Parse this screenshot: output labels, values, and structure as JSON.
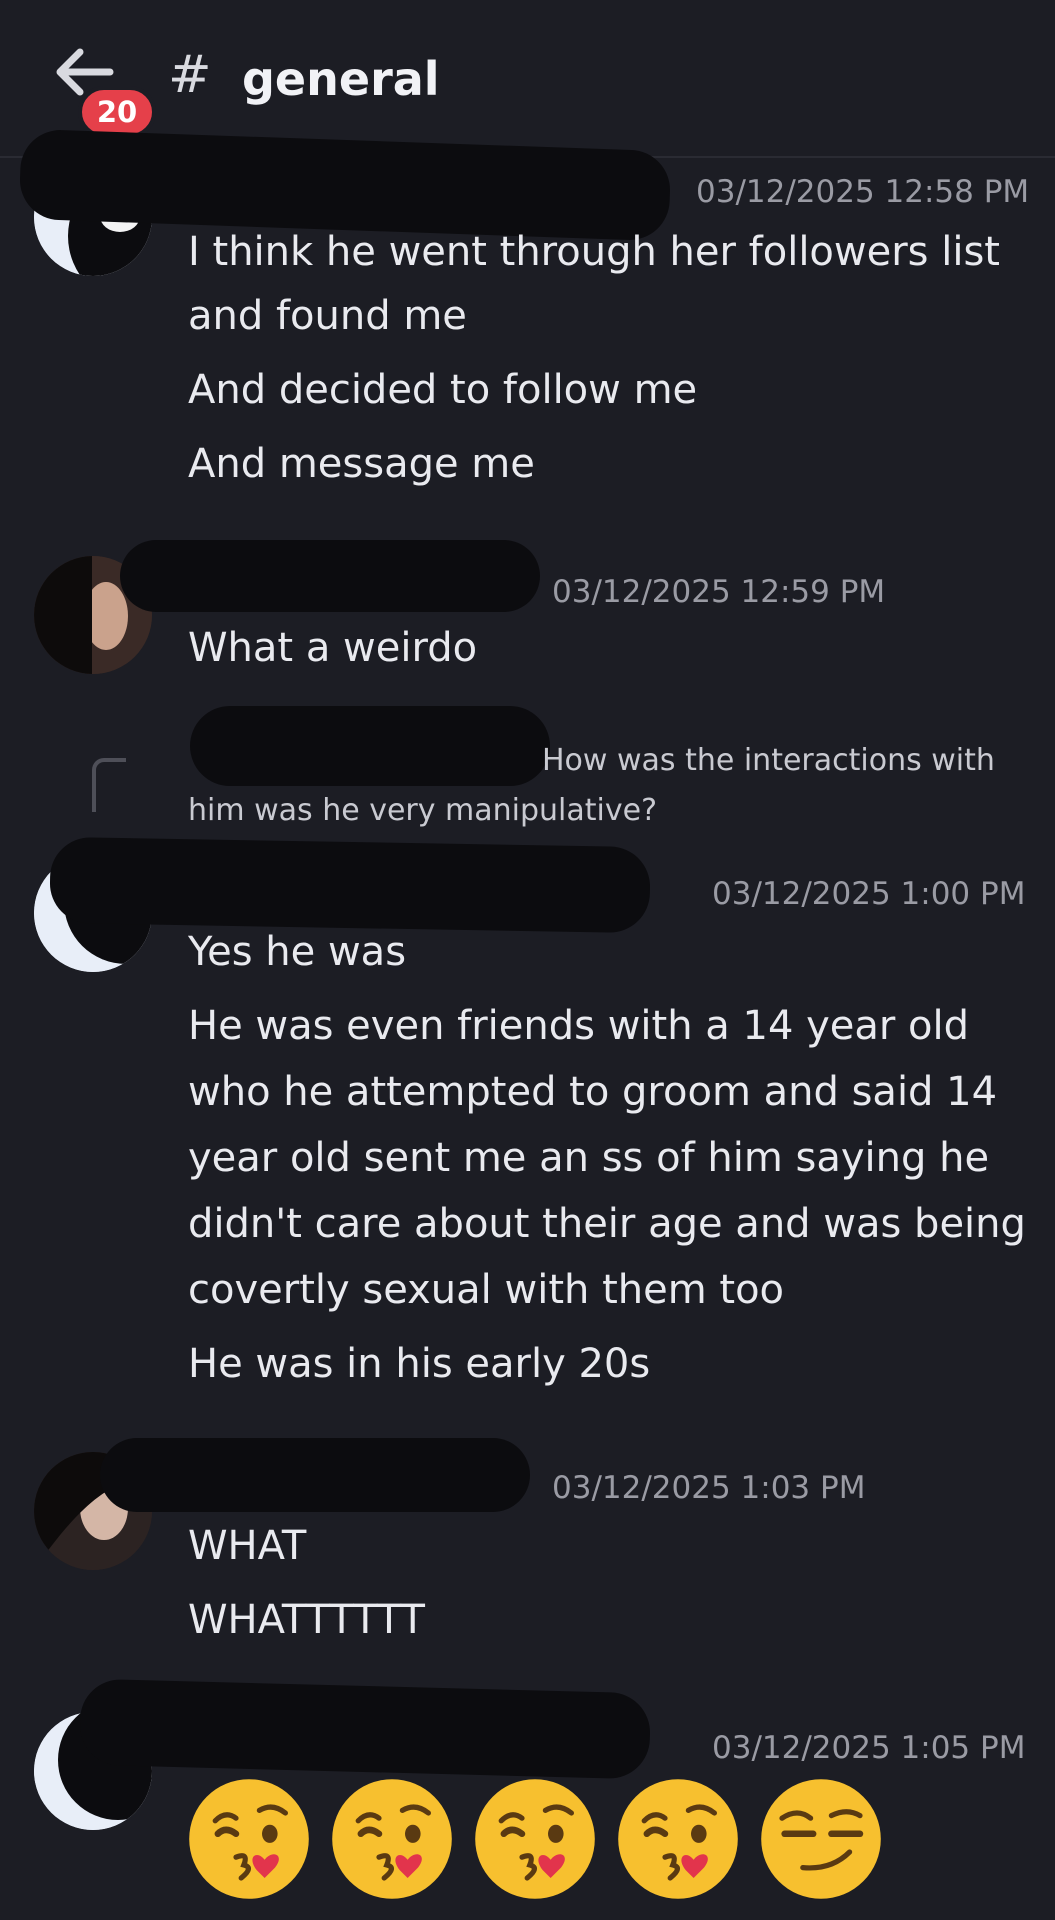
{
  "header": {
    "unread_count": "20",
    "channel_hash": "#",
    "channel_name": "general"
  },
  "messages": [
    {
      "timestamp": "03/12/2025 12:58 PM",
      "lines": [
        "I think he went through her followers list",
        "and found me",
        "And decided to follow me",
        "And message me"
      ]
    },
    {
      "timestamp": "03/12/2025 12:59 PM",
      "lines": [
        "What a weirdo"
      ]
    },
    {
      "reply_preview": {
        "text_line1": "How was the interactions with",
        "text_line2": "him was he very manipulative?"
      },
      "timestamp": "03/12/2025 1:00 PM",
      "lines": [
        "Yes he was",
        "He was even friends with a 14 year old",
        "who he attempted to groom and said 14",
        "year old sent me an ss of him saying he",
        "didn't care about their age and was being",
        "covertly sexual with them too",
        "He was in his early 20s"
      ]
    },
    {
      "timestamp": "03/12/2025 1:03 PM",
      "lines": [
        "WHAT",
        "WHATTTTTT"
      ]
    },
    {
      "timestamp": "03/12/2025 1:05 PM",
      "emojis": [
        "kissing-heart-emoji",
        "kissing-heart-emoji",
        "kissing-heart-emoji",
        "kissing-heart-emoji",
        "smirk-emoji"
      ]
    }
  ],
  "colors": {
    "background": "#1c1d24",
    "badge": "#e5404a",
    "timestamp": "#9a9ba4",
    "text": "#e9eaef"
  }
}
